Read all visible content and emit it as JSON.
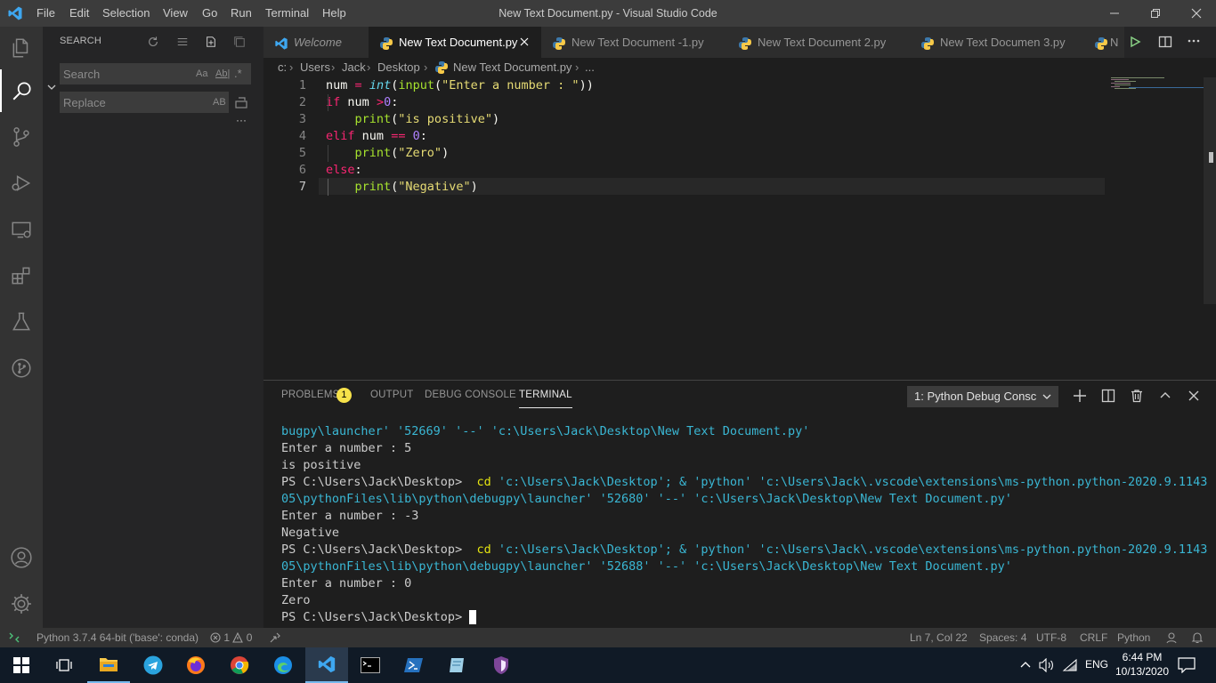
{
  "titlebar": {
    "title": "New Text Document.py - Visual Studio Code",
    "menu": [
      "File",
      "Edit",
      "Selection",
      "View",
      "Go",
      "Run",
      "Terminal",
      "Help"
    ]
  },
  "sidebar": {
    "title": "SEARCH",
    "search_placeholder": "Search",
    "replace_placeholder": "Replace",
    "match_case": "Aa",
    "whole_word": "Ab|",
    "regex": ".*",
    "preserve_case": "AB",
    "more": "···"
  },
  "tabs": [
    {
      "label": "Welcome",
      "active": false
    },
    {
      "label": "New Text Document.py",
      "active": true
    },
    {
      "label": "New Text Document -1.py",
      "active": false
    },
    {
      "label": "New Text Document 2.py",
      "active": false
    },
    {
      "label": "New Text Documen 3.py",
      "active": false
    },
    {
      "label": "N",
      "active": false
    }
  ],
  "breadcrumb": [
    "c:",
    "Users",
    "Jack",
    "Desktop",
    "New Text Document.py",
    "..."
  ],
  "editor": {
    "line_numbers": [
      "1",
      "2",
      "3",
      "4",
      "5",
      "6",
      "7"
    ],
    "lines": [
      "num = int(input(\"Enter a number : \"))",
      "if num >0:",
      "    print(\"is positive\")",
      "elif num == 0:",
      "    print(\"Zero\")",
      "else:",
      "    print(\"Negative\")"
    ]
  },
  "panel": {
    "tabs": [
      "PROBLEMS",
      "OUTPUT",
      "DEBUG CONSOLE",
      "TERMINAL"
    ],
    "problems_count": "1",
    "terminal_select": "1: Python Debug Consc",
    "terminal_lines": [
      "bugpy\\launcher' '52669' '--' 'c:\\Users\\Jack\\Desktop\\New Text Document.py'",
      "Enter a number : 5",
      "is positive",
      "PS C:\\Users\\Jack\\Desktop>  cd 'c:\\Users\\Jack\\Desktop'; & 'python' 'c:\\Users\\Jack\\.vscode\\extensions\\ms-python.python-2020.9.1143",
      "05\\pythonFiles\\lib\\python\\debugpy\\launcher' '52680' '--' 'c:\\Users\\Jack\\Desktop\\New Text Document.py'",
      "Enter a number : -3",
      "Negative",
      "PS C:\\Users\\Jack\\Desktop>  cd 'c:\\Users\\Jack\\Desktop'; & 'python' 'c:\\Users\\Jack\\.vscode\\extensions\\ms-python.python-2020.9.1143",
      "05\\pythonFiles\\lib\\python\\debugpy\\launcher' '52688' '--' 'c:\\Users\\Jack\\Desktop\\New Text Document.py'",
      "Enter a number : 0",
      "Zero",
      "PS C:\\Users\\Jack\\Desktop> "
    ]
  },
  "statusbar": {
    "interpreter": "Python 3.7.4 64-bit ('base': conda)",
    "errors": "1",
    "warnings": "0",
    "position": "Ln 7, Col 22",
    "spaces": "Spaces: 4",
    "encoding": "UTF-8",
    "eol": "CRLF",
    "language": "Python"
  },
  "taskbar": {
    "language": "ENG",
    "time": "6:44 PM",
    "date": "10/13/2020"
  },
  "colors": {
    "accent": "#0078d4",
    "statusbar": "#333333",
    "editor_bg": "#1e1e1e",
    "sidebar_bg": "#252526",
    "taskbar_bg": "#101a26"
  }
}
